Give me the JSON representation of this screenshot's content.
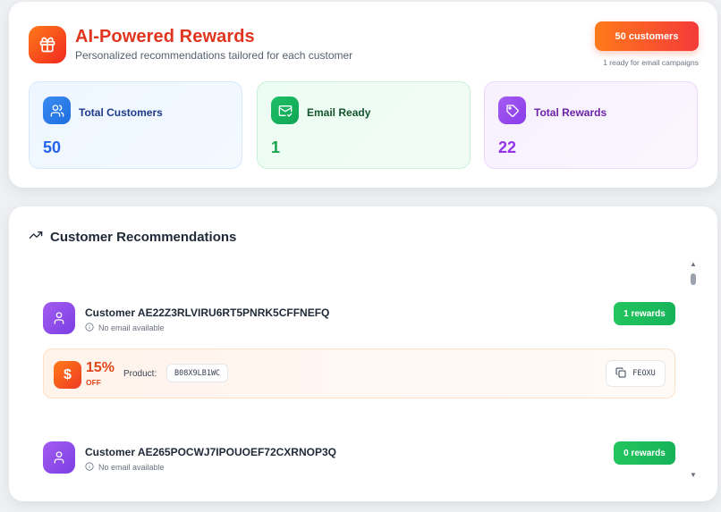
{
  "header": {
    "title": "AI-Powered Rewards",
    "subtitle": "Personalized recommendations tailored for each customer",
    "customers_pill": "50 customers",
    "ready_note": "1 ready for email campaigns"
  },
  "stats": {
    "total_customers": {
      "label": "Total Customers",
      "value": "50"
    },
    "email_ready": {
      "label": "Email Ready",
      "value": "1"
    },
    "total_rewards": {
      "label": "Total Rewards",
      "value": "22"
    }
  },
  "recommendations": {
    "title": "Customer Recommendations",
    "customers": [
      {
        "name": "Customer AE22Z3RLVIRU6RT5PNRK5CFFNEFQ",
        "email_status": "No email available",
        "rewards": "1 rewards"
      },
      {
        "name": "Customer AE265POCWJ7IPOUOEF72CXRNOP3Q",
        "email_status": "No email available",
        "rewards": "0 rewards"
      }
    ],
    "offer": {
      "percent": "15%",
      "off": "OFF",
      "product_label": "Product:",
      "product_code": "B08X9LB1WC",
      "coupon_code": "FEOXU"
    }
  },
  "colors": {
    "brand_orange": "#ff7a1a",
    "brand_red": "#e0361f",
    "success_green": "#22c55e",
    "purple": "#9333ea",
    "blue": "#2563eb"
  },
  "icons": {
    "header": "gift-icon",
    "total_customers": "users-icon",
    "email_ready": "mail-check-icon",
    "total_rewards": "tag-icon",
    "recommendations": "trending-up-icon",
    "avatar": "user-icon",
    "no_email": "info-icon",
    "offer": "dollar-icon",
    "copy": "copy-icon"
  }
}
